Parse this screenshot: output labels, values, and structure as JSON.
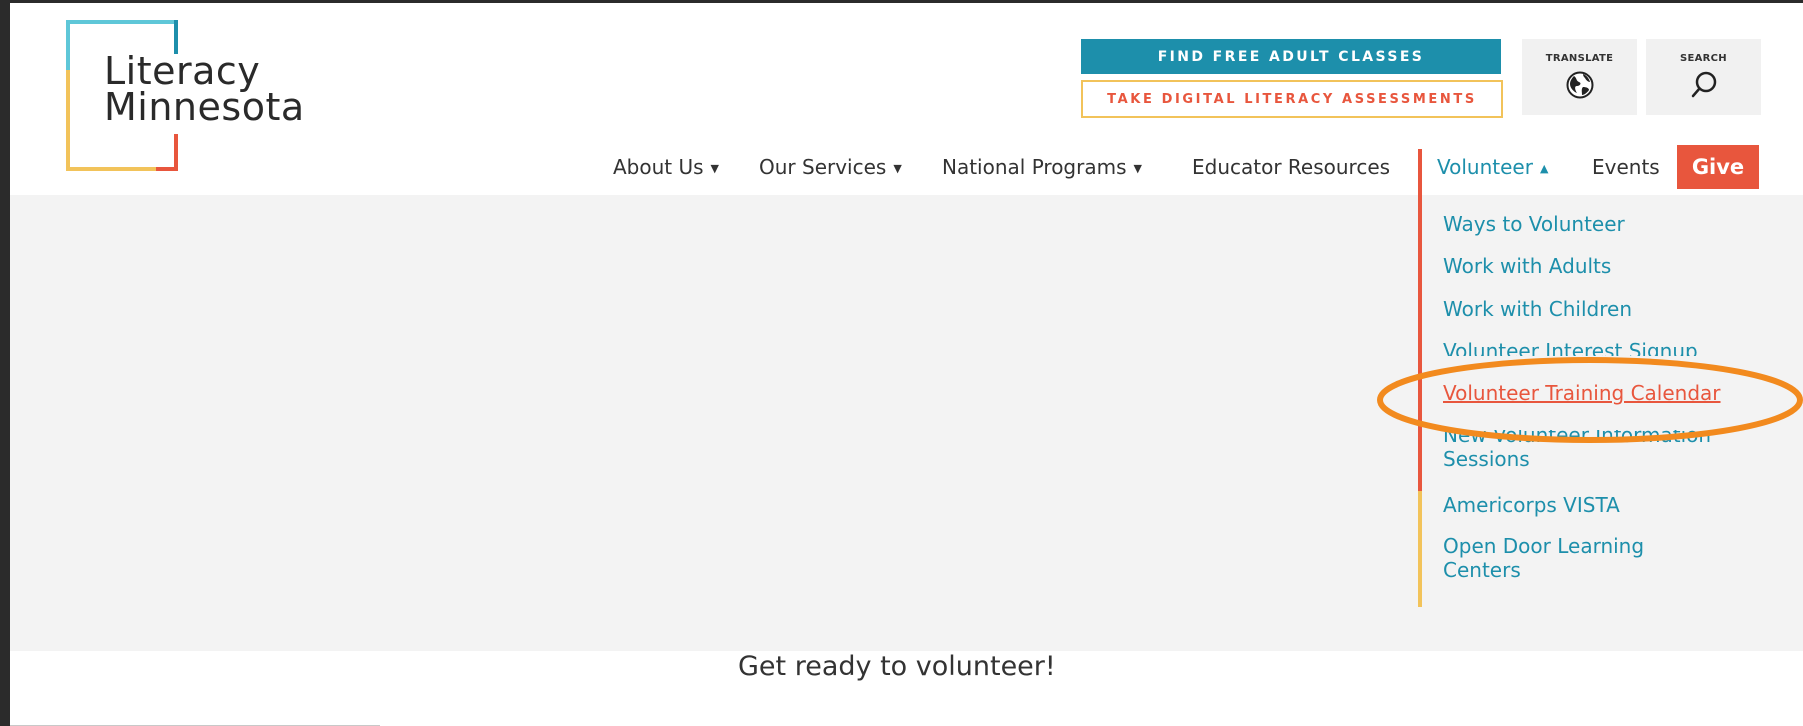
{
  "logo": {
    "line1": "Literacy",
    "line2": "Minnesota"
  },
  "utility": {
    "find_classes": "FIND FREE ADULT CLASSES",
    "digital_assessments": "TAKE DIGITAL LITERACY ASSESSMENTS",
    "translate_label": "TRANSLATE",
    "search_label": "SEARCH"
  },
  "nav": {
    "about": "About Us",
    "services": "Our Services",
    "national": "National Programs",
    "educator": "Educator Resources",
    "volunteer": "Volunteer",
    "events": "Events",
    "give": "Give"
  },
  "dropdown": {
    "ways": "Ways to Volunteer",
    "adults": "Work with Adults",
    "children": "Work with Children",
    "interest": "Volunteer Interest Signup",
    "training": "Volunteer Training Calendar",
    "new_info_1": "New Volunteer Information",
    "new_info_2": "Sessions",
    "americorps": "Americorps VISTA",
    "open_door_1": "Open Door Learning",
    "open_door_2": "Centers"
  },
  "main": {
    "heading": "Get ready to volunteer!"
  },
  "colors": {
    "teal": "#1d8fab",
    "orange_red": "#e8563d",
    "yellow": "#f2c35a",
    "highlight": "#f28a1e"
  },
  "icons": {
    "translate": "globe-icon",
    "search": "search-icon",
    "caret": "caret-down-icon",
    "caret_up": "caret-up-icon"
  }
}
